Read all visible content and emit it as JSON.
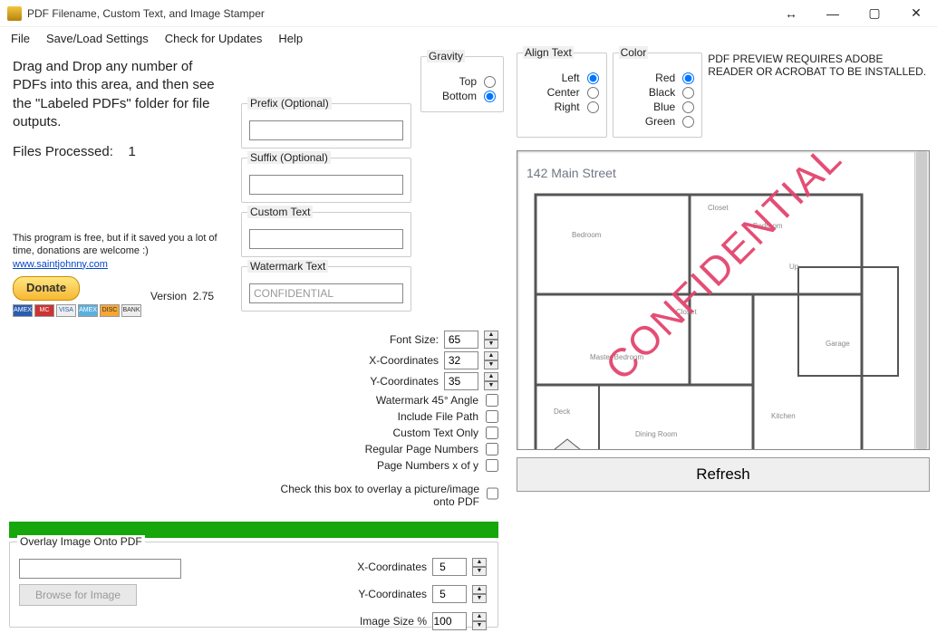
{
  "window": {
    "title": "PDF Filename, Custom Text, and Image Stamper"
  },
  "menu": {
    "file": "File",
    "saveload": "Save/Load Settings",
    "updates": "Check for Updates",
    "help": "Help"
  },
  "left": {
    "drag_text": "Drag and Drop any number of PDFs into this area, and then see the \"Labeled PDFs\" folder for file outputs.",
    "files_label": "Files Processed:",
    "files_count": "1",
    "about1": "This program is free, but if it saved you a lot of time, donations are welcome :)",
    "link": "www.saintjohnny.com",
    "donate": "Donate",
    "version_label": "Version",
    "version": "2.75",
    "cards": [
      "AMEX",
      "MC",
      "VISA",
      "AMEX",
      "DISC",
      "BANK"
    ]
  },
  "inputs": {
    "prefix_legend": "Prefix (Optional)",
    "prefix_value": "",
    "suffix_legend": "Suffix (Optional)",
    "suffix_value": "",
    "custom_legend": "Custom Text",
    "custom_value": "",
    "watermark_legend": "Watermark Text",
    "watermark_value": "CONFIDENTIAL"
  },
  "gravity": {
    "legend": "Gravity",
    "top": "Top",
    "bottom": "Bottom",
    "selected": "bottom"
  },
  "align": {
    "legend": "Align Text",
    "left": "Left",
    "center": "Center",
    "right": "Right",
    "selected": "left"
  },
  "color": {
    "legend": "Color",
    "red": "Red",
    "black": "Black",
    "blue": "Blue",
    "green": "Green",
    "selected": "red"
  },
  "nums": {
    "font_label": "Font Size:",
    "font_val": "65",
    "x_label": "X-Coordinates",
    "x_val": "32",
    "y_label": "Y-Coordinates",
    "y_val": "35"
  },
  "checks": {
    "angle": "Watermark 45° Angle",
    "filepath": "Include File Path",
    "customonly": "Custom Text Only",
    "pagenums": "Regular Page Numbers",
    "pagexofy": "Page Numbers x of y",
    "overlaydesc": "Check this box to overlay a picture/image onto PDF"
  },
  "overlay": {
    "legend": "Overlay Image Onto PDF",
    "browse": "Browse for Image",
    "x_label": "X-Coordinates",
    "x_val": "5",
    "y_label": "Y-Coordinates",
    "y_val": "5",
    "size_label": "Image Size %",
    "size_val": "100"
  },
  "preview": {
    "warn": "PDF PREVIEW REQUIRES ADOBE READER OR ACROBAT TO BE INSTALLED.",
    "address": "142 Main Street",
    "watermark": "CONFIDENTIAL",
    "refresh": "Refresh",
    "rooms": {
      "bedroom": "Bedroom",
      "bedroom2": "Bedroom",
      "closet": "Closet",
      "closet2": "Closet",
      "master": "Master Bedroom",
      "garage": "Garage",
      "kitchen": "Kitchen",
      "dining": "Dining Room",
      "deck": "Deck",
      "up": "Up"
    }
  }
}
